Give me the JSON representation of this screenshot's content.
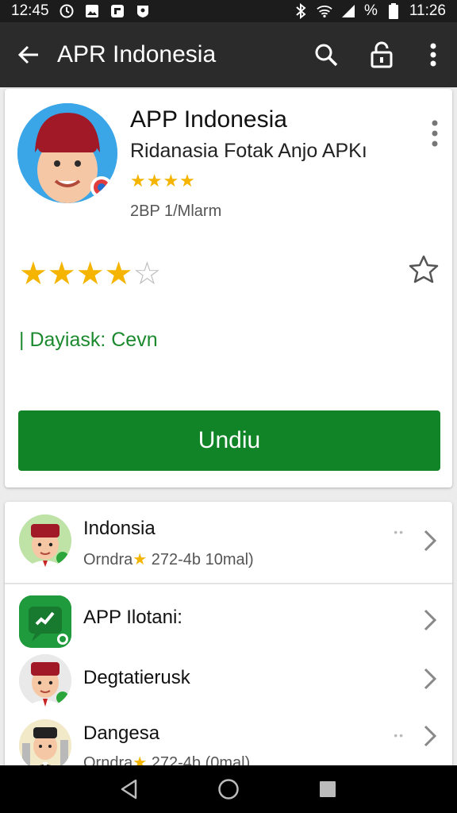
{
  "status": {
    "time_left": "12:45",
    "battery_text": "%",
    "time_right": "11:26"
  },
  "app_bar": {
    "title": "APR Indonesia"
  },
  "app": {
    "name": "APP Indonesia",
    "subtitle": "Ridanasia Fotak Anjo APKı",
    "small_rating_stars": "★★★★",
    "meta": "2BP 1/Mlarm",
    "download_info": "| Dayiask: Cevn",
    "install_label": "Undiu"
  },
  "rating": {
    "filled_stars": "★★★★",
    "empty_star": "☆",
    "value": 4,
    "max": 5
  },
  "list": [
    {
      "name": "Indonsia",
      "detail_pre": "Orndra",
      "detail_post": " 272-4b 10mal)",
      "icon": "avatar-icon",
      "dots": "••"
    },
    {
      "name": "APP Ilotani:",
      "icon": "app-check-icon"
    },
    {
      "name": "Degtatierusk",
      "icon": "avatar-icon"
    },
    {
      "name": "Dangesa",
      "detail_pre": "Orndra",
      "detail_post": " 272-4b (0mal)",
      "icon": "avatar-icon",
      "dots": "••"
    }
  ],
  "colors": {
    "install_green": "#118428",
    "download_text_green": "#1b8a2e",
    "star_yellow": "#f4b400",
    "app_bar": "#2b2b2b"
  }
}
